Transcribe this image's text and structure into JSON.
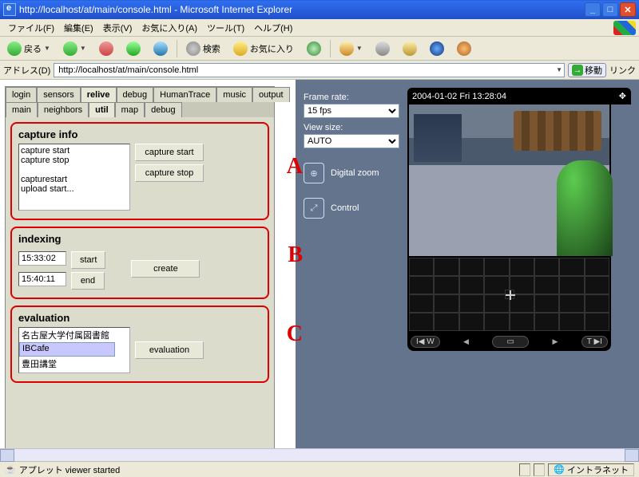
{
  "window": {
    "title": "http://localhost/at/main/console.html - Microsoft Internet Explorer"
  },
  "menu": {
    "file": "ファイル(F)",
    "edit": "編集(E)",
    "view": "表示(V)",
    "favorites": "お気に入り(A)",
    "tools": "ツール(T)",
    "help": "ヘルプ(H)"
  },
  "toolbar": {
    "back": "戻る",
    "search": "検索",
    "favorites": "お気に入り"
  },
  "address": {
    "label": "アドレス(D)",
    "url": "http://localhost/at/main/console.html",
    "go": "移動",
    "links": "リンク"
  },
  "tabs_row1": {
    "login": "login",
    "sensors": "sensors",
    "relive": "relive",
    "debug": "debug",
    "humantrace": "HumanTrace",
    "music": "music",
    "output": "output"
  },
  "tabs_row2": {
    "main": "main",
    "neighbors": "neighbors",
    "util": "util",
    "map": "map",
    "debug": "debug"
  },
  "capture": {
    "legend": "capture info",
    "log": "capture start\ncapture stop\n\ncapturestart\nupload start...",
    "btn_start": "capture start",
    "btn_stop": "capture stop"
  },
  "indexing": {
    "legend": "indexing",
    "t1": "15:33:02",
    "t2": "15:40:11",
    "btn_start": "start",
    "btn_end": "end",
    "btn_create": "create"
  },
  "evaluation": {
    "legend": "evaluation",
    "items": {
      "i0": "名古屋大学付属図書館",
      "i1": "IBCafe",
      "i2": "豊田講堂"
    },
    "btn": "evaluation"
  },
  "annot": {
    "a": "A",
    "b": "B",
    "c": "C"
  },
  "cam": {
    "frame_label": "Frame rate:",
    "frame_val": "15 fps",
    "view_label": "View size:",
    "view_val": "AUTO",
    "zoom": "Digital zoom",
    "control": "Control",
    "timestamp": "2004-01-02 Fri 13:28:04",
    "btn_rev": "I◀ W",
    "btn_fwd": "T ▶I",
    "btn_rev2": "I◀W",
    "btn_fwd2": "T▶I"
  },
  "status": {
    "applet": "アプレット viewer started",
    "intranet": "イントラネット"
  }
}
